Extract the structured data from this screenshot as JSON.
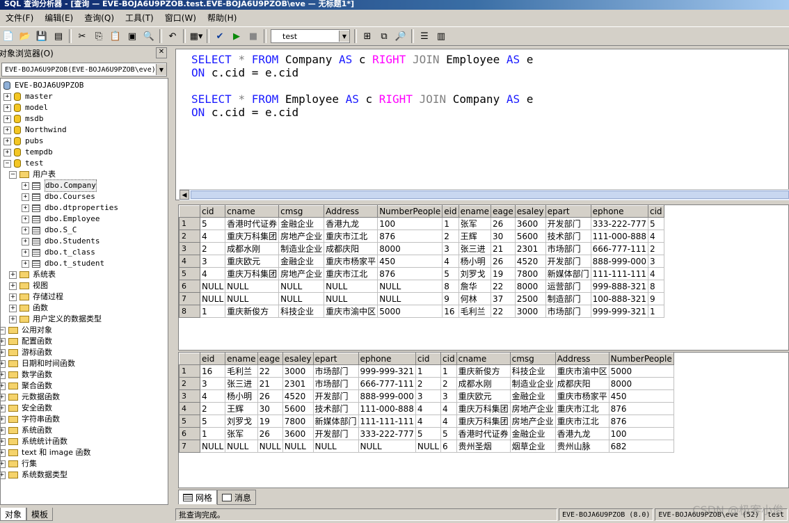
{
  "window": {
    "title": "SQL 查询分析器 - [查询 — EVE-BOJA6U9PZOB.test.EVE-BOJA6U9PZOB\\eve — 无标题1*]"
  },
  "menu": [
    "文件(F)",
    "编辑(E)",
    "查询(Q)",
    "工具(T)",
    "窗口(W)",
    "帮助(H)"
  ],
  "toolbar": {
    "database": "test"
  },
  "object_browser": {
    "title": "对象浏览器(O)",
    "server_select": "EVE-BOJA6U9PZOB(EVE-BOJA6U9PZOB\\eve)",
    "tree": {
      "server": "EVE-BOJA6U9PZOB",
      "databases": [
        "master",
        "model",
        "msdb",
        "Northwind",
        "pubs",
        "tempdb",
        "test"
      ],
      "user_tables_folder": "用户表",
      "tables": [
        "dbo.Company",
        "dbo.Courses",
        "dbo.dtproperties",
        "dbo.Employee",
        "dbo.S_C",
        "dbo.Students",
        "dbo.t_class",
        "dbo.t_student"
      ],
      "test_folders": [
        "系统表",
        "视图",
        "存储过程",
        "函数",
        "用户定义的数据类型"
      ],
      "common": "公用对象",
      "common_items": [
        "配置函数",
        "游标函数",
        "日期和时间函数",
        "数学函数",
        "聚合函数",
        "元数据函数",
        "安全函数",
        "字符串函数",
        "系统函数",
        "系统统计函数",
        "text 和 image 函数",
        "行集",
        "系统数据类型"
      ]
    },
    "tabs": [
      "对象",
      "模板"
    ]
  },
  "editor": {
    "q1": {
      "select": "SELECT",
      "star": "*",
      "from": "FROM",
      "t1": "Company",
      "as1": "AS",
      "a1": "c",
      "join_kind": "RIGHT",
      "join": "JOIN",
      "t2": "Employee",
      "as2": "AS",
      "a2": "e",
      "on": "ON",
      "cond": "c.cid = e.cid"
    },
    "q2": {
      "select": "SELECT",
      "star": "*",
      "from": "FROM",
      "t1": "Employee",
      "as1": "AS",
      "a1": "c",
      "join_kind": "RIGHT",
      "join": "JOIN",
      "t2": "Company",
      "as2": "AS",
      "a2": "e",
      "on": "ON",
      "cond": "c.cid = e.cid"
    }
  },
  "result1": {
    "columns": [
      "cid",
      "cname",
      "cmsg",
      "Address",
      "NumberPeople",
      "eid",
      "ename",
      "eage",
      "esaley",
      "epart",
      "ephone",
      "cid"
    ],
    "rows": [
      [
        "5",
        "香港时代证券",
        "金融企业",
        "香港九龙",
        "100",
        "1",
        "张军",
        "26",
        "3600",
        "开发部门",
        "333-222-777",
        "5"
      ],
      [
        "4",
        "重庆万科集团",
        "房地产企业",
        "重庆市江北",
        "876",
        "2",
        "王辉",
        "30",
        "5600",
        "技术部门",
        "111-000-888",
        "4"
      ],
      [
        "2",
        "成都水刚",
        "制造业企业",
        "成都庆阳",
        "8000",
        "3",
        "张三进",
        "21",
        "2301",
        "市场部门",
        "666-777-111",
        "2"
      ],
      [
        "3",
        "重庆欧元",
        "金融企业",
        "重庆市杨家平",
        "450",
        "4",
        "杨小明",
        "26",
        "4520",
        "开发部门",
        "888-999-000",
        "3"
      ],
      [
        "4",
        "重庆万科集团",
        "房地产企业",
        "重庆市江北",
        "876",
        "5",
        "刘罗戈",
        "19",
        "7800",
        "新媒体部门",
        "111-111-111",
        "4"
      ],
      [
        "NULL",
        "NULL",
        "NULL",
        "NULL",
        "NULL",
        "8",
        "詹华",
        "22",
        "8000",
        "运营部门",
        "999-888-321",
        "8"
      ],
      [
        "NULL",
        "NULL",
        "NULL",
        "NULL",
        "NULL",
        "9",
        "何林",
        "37",
        "2500",
        "制造部门",
        "100-888-321",
        "9"
      ],
      [
        "1",
        "重庆新俊方",
        "科技企业",
        "重庆市渝中区",
        "5000",
        "16",
        "毛利兰",
        "22",
        "3000",
        "市场部门",
        "999-999-321",
        "1"
      ]
    ]
  },
  "result2": {
    "columns": [
      "eid",
      "ename",
      "eage",
      "esaley",
      "epart",
      "ephone",
      "cid",
      "cid",
      "cname",
      "cmsg",
      "Address",
      "NumberPeople"
    ],
    "rows": [
      [
        "16",
        "毛利兰",
        "22",
        "3000",
        "市场部门",
        "999-999-321",
        "1",
        "1",
        "重庆新俊方",
        "科技企业",
        "重庆市渝中区",
        "5000"
      ],
      [
        "3",
        "张三进",
        "21",
        "2301",
        "市场部门",
        "666-777-111",
        "2",
        "2",
        "成都水刚",
        "制造业企业",
        "成都庆阳",
        "8000"
      ],
      [
        "4",
        "杨小明",
        "26",
        "4520",
        "开发部门",
        "888-999-000",
        "3",
        "3",
        "重庆欧元",
        "金融企业",
        "重庆市杨家平",
        "450"
      ],
      [
        "2",
        "王辉",
        "30",
        "5600",
        "技术部门",
        "111-000-888",
        "4",
        "4",
        "重庆万科集团",
        "房地产企业",
        "重庆市江北",
        "876"
      ],
      [
        "5",
        "刘罗戈",
        "19",
        "7800",
        "新媒体部门",
        "111-111-111",
        "4",
        "4",
        "重庆万科集团",
        "房地产企业",
        "重庆市江北",
        "876"
      ],
      [
        "1",
        "张军",
        "26",
        "3600",
        "开发部门",
        "333-222-777",
        "5",
        "5",
        "香港时代证券",
        "金融企业",
        "香港九龙",
        "100"
      ],
      [
        "NULL",
        "NULL",
        "NULL",
        "NULL",
        "NULL",
        "NULL",
        "NULL",
        "6",
        "贵州圣烟",
        "烟草企业",
        "贵州山脉",
        "682"
      ]
    ]
  },
  "result_tabs": [
    "网格",
    "消息"
  ],
  "status": {
    "message": "批查询完成。",
    "server": "EVE-BOJA6U9PZOB (8.0)",
    "user": "EVE-BOJA6U9PZOB\\eve (52)",
    "db": "test"
  },
  "watermark": "CSDN @极客小俊"
}
